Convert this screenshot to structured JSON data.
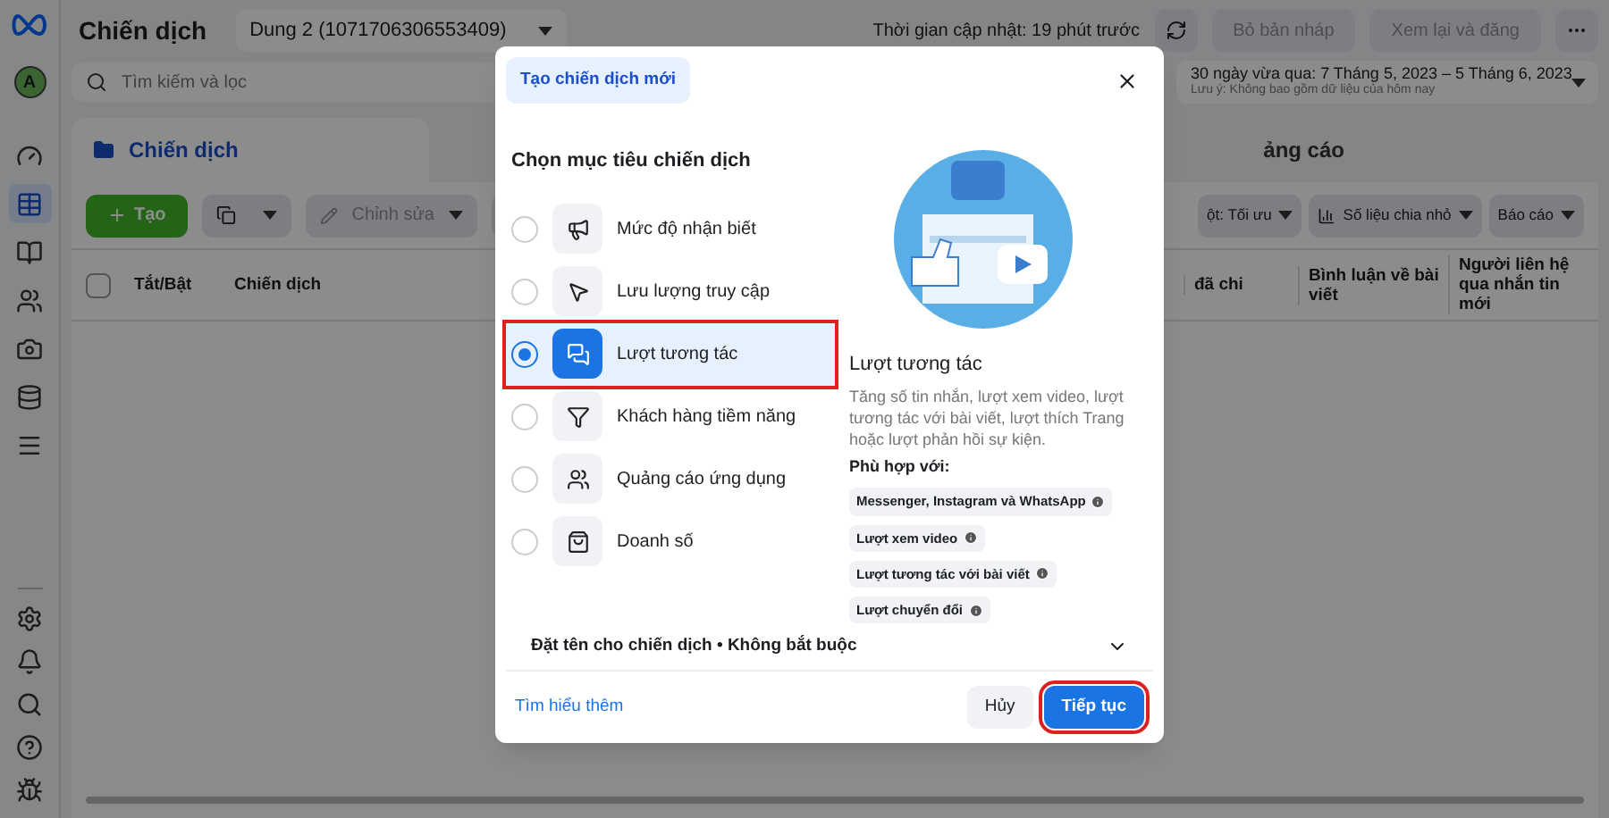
{
  "sidebar": {
    "avatar": "A",
    "items": [
      {
        "selected": false
      },
      {
        "selected": true
      },
      {
        "selected": false
      },
      {
        "selected": false
      },
      {
        "selected": false
      },
      {
        "selected": false
      },
      {
        "selected": false
      }
    ]
  },
  "header": {
    "title": "Chiến dịch",
    "account": "Dung 2 (1071706306553409)",
    "updated": "Thời gian cập nhật: 19 phút trước",
    "buttons": [
      "Bỏ bản nháp",
      "Xem lại và đăng"
    ]
  },
  "search": {
    "placeholder": "Tìm kiếm và lọc"
  },
  "date_range": {
    "label": "30 ngày vừa qua: 7 Tháng 5, 2023 – 5 Tháng 6, 2023",
    "note": "Lưu ý: Không bao gồm dữ liệu của hôm nay"
  },
  "tabs": [
    {
      "label": "Chiến dịch",
      "selected": true
    },
    {
      "label": "ảng cáo",
      "selected": false
    }
  ],
  "toolbar": {
    "create": "Tạo",
    "edit": "Chỉnh sửa",
    "right": [
      "ột: Tối ưu",
      "Số liệu chia nhỏ",
      "Báo cáo"
    ]
  },
  "table": {
    "select_all_checked": false,
    "columns": [
      "Tắt/Bật",
      "Chiến dịch",
      "đã chi",
      "Bình luận về bài viết",
      "Người liên hệ qua nhắn tin mới"
    ]
  },
  "dialog": {
    "chip": "Tạo chiến dịch mới",
    "heading": "Chọn mục tiêu chiến dịch",
    "options": [
      {
        "label": "Mức độ nhận biết",
        "selected": false,
        "highlighted": false
      },
      {
        "label": "Lưu lượng truy cập",
        "selected": false,
        "highlighted": false
      },
      {
        "label": "Lượt tương tác",
        "selected": true,
        "highlighted": true
      },
      {
        "label": "Khách hàng tiềm năng",
        "selected": false,
        "highlighted": false
      },
      {
        "label": "Quảng cáo ứng dụng",
        "selected": false,
        "highlighted": false
      },
      {
        "label": "Doanh số",
        "selected": false,
        "highlighted": false
      }
    ],
    "detail": {
      "title": "Lượt tương tác",
      "description": "Tăng số tin nhắn, lượt xem video, lượt tương tác với bài viết, lượt thích Trang hoặc lượt phản hồi sự kiện.",
      "fits_label": "Phù hợp với:",
      "fits": [
        "Messenger, Instagram và WhatsApp",
        "Lượt xem video",
        "Lượt tương tác với bài viết",
        "Lượt chuyển đổi"
      ]
    },
    "name_row": "Đặt tên cho chiến dịch • Không bắt buộc",
    "learn_more": "Tìm hiểu thêm",
    "cancel": "Hủy",
    "continue": {
      "label": "Tiếp tục",
      "highlighted": true
    }
  }
}
